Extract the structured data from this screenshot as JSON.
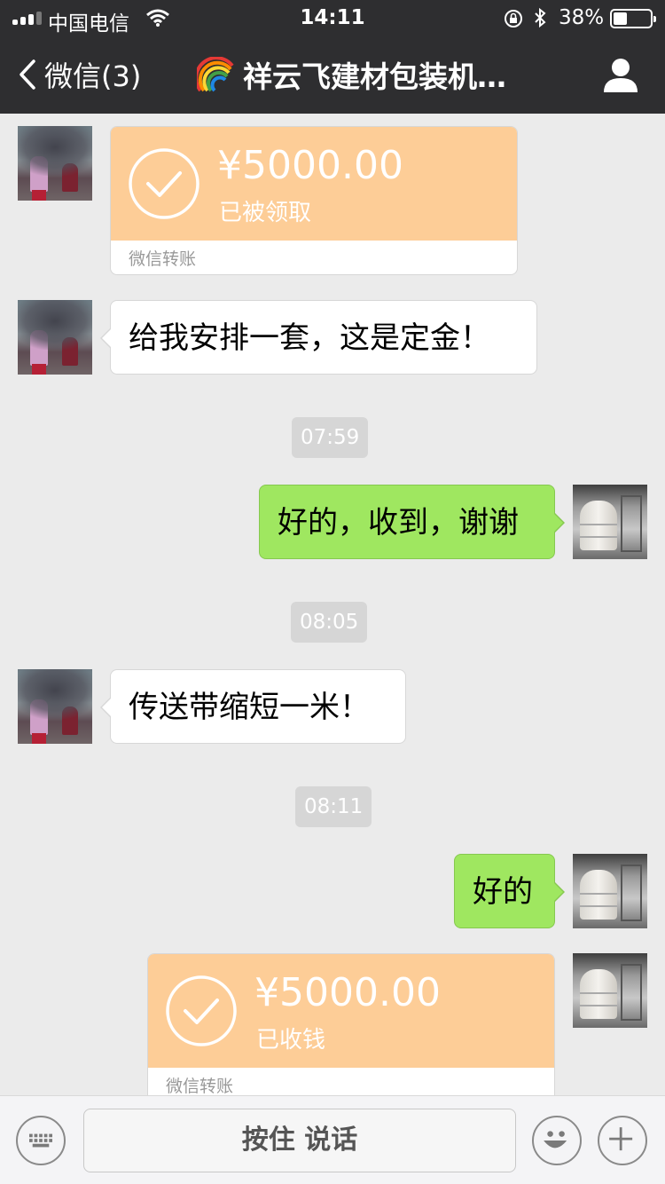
{
  "status_bar": {
    "carrier": "中国电信",
    "time": "14:11",
    "battery_percent": "38%",
    "battery_level": 0.38
  },
  "nav": {
    "back_label": "微信(3)",
    "title": "祥云飞建材包装机…"
  },
  "messages": {
    "transfer1": {
      "amount": "¥5000.00",
      "status": "已被领取",
      "label": "微信转账"
    },
    "text1": "给我安排一套，这是定金！",
    "time1": "07:59",
    "text2": "好的，收到，谢谢",
    "time2": "08:05",
    "text3": "传送带缩短一米！",
    "time3": "08:11",
    "text4": "好的",
    "transfer2": {
      "amount": "¥5000.00",
      "status": "已收钱",
      "label": "微信转账"
    }
  },
  "input_bar": {
    "hold_to_talk": "按住 说话"
  },
  "colors": {
    "nav_bg": "#2e2e30",
    "chat_bg": "#ebebeb",
    "outgoing_bubble": "#9fe760",
    "transfer_orange": "#fdcd97"
  }
}
